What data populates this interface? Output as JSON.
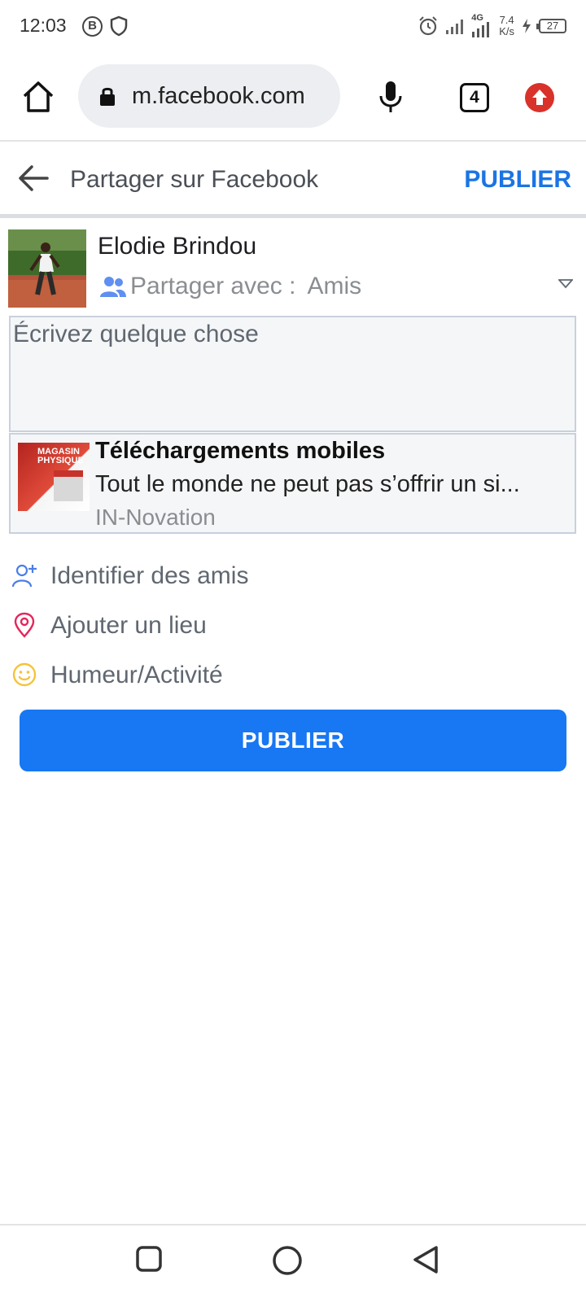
{
  "status_bar": {
    "time": "12:03",
    "b_badge": "B",
    "network": "4G",
    "speed_value": "7.4",
    "speed_unit": "K/s",
    "battery": "27"
  },
  "browser": {
    "url": "m.facebook.com",
    "tab_count": "4"
  },
  "header": {
    "title": "Partager sur Facebook",
    "publish_label": "PUBLIER"
  },
  "user": {
    "name": "Elodie Brindou",
    "audience_label": "Partager avec :",
    "audience_value": "Amis"
  },
  "composer": {
    "placeholder": "Écrivez quelque chose"
  },
  "link_preview": {
    "thumb_text": "MAGASIN PHYSIQUE",
    "title": "Téléchargements mobiles",
    "description": "Tout le monde ne peut pas s’offrir un si...",
    "source": "IN-Novation"
  },
  "options": {
    "tag_friends": "Identifier des amis",
    "add_place": "Ajouter un lieu",
    "mood": "Humeur/Activité"
  },
  "publish_button": "PUBLIER",
  "colors": {
    "brand_blue": "#1877f2",
    "header_blue": "#1b74e4",
    "place_icon": "#e4265c",
    "mood_icon": "#f5c33b",
    "tag_icon": "#4a7ee8"
  }
}
